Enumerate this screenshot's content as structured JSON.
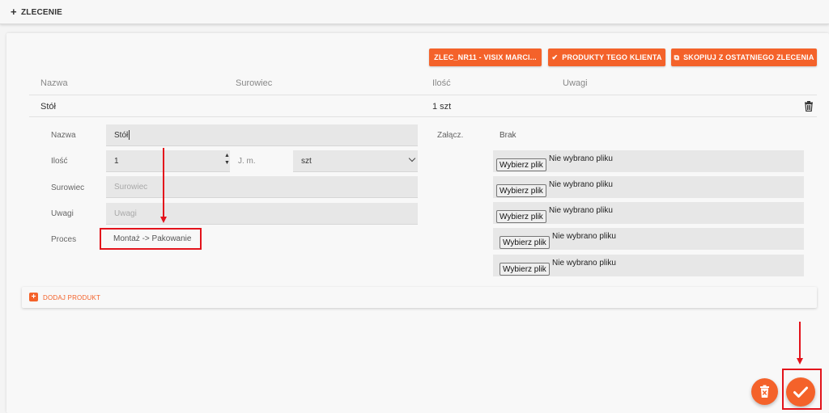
{
  "topbar": {
    "plus_icon": "+",
    "title": "ZLECENIE"
  },
  "actions": {
    "order_label": "ZLEC_NR11 - VISIX MARCI...",
    "products_label": "PRODUKTY TEGO KLIENTA",
    "copy_label": "SKOPIUJ Z OSTATNIEGO ZLECENIA",
    "check_icon": "check-icon",
    "copy_icon": "copy-icon"
  },
  "table": {
    "headers": {
      "name": "Nazwa",
      "material": "Surowiec",
      "quantity": "Ilość",
      "notes": "Uwagi"
    },
    "row": {
      "name": "Stół",
      "quantity": "1 szt"
    }
  },
  "form": {
    "name_label": "Nazwa",
    "name_value": "Stół",
    "qty_label": "Ilość",
    "qty_value": "1",
    "unit_label": "J. m.",
    "unit_value": "szt",
    "material_label": "Surowiec",
    "material_placeholder": "Surowiec",
    "notes_label": "Uwagi",
    "notes_placeholder": "Uwagi",
    "process_label": "Proces",
    "process_value": "Montaż -> Pakowanie",
    "attachments_label": "Załącz.",
    "attachments_value": "Brak"
  },
  "files": [
    {
      "button": "Wybierz plik",
      "status": "Nie wybrano pliku"
    },
    {
      "button": "Wybierz plik",
      "status": "Nie wybrano pliku"
    },
    {
      "button": "Wybierz plik",
      "status": "Nie wybrano pliku"
    },
    {
      "button": "Wybierz plik",
      "status": "Nie wybrano pliku"
    },
    {
      "button": "Wybierz plik",
      "status": "Nie wybrano pliku"
    }
  ],
  "add_product": {
    "label": "DODAJ PRODUKT"
  },
  "colors": {
    "accent": "#f4622a",
    "annotation": "#e3131b"
  }
}
